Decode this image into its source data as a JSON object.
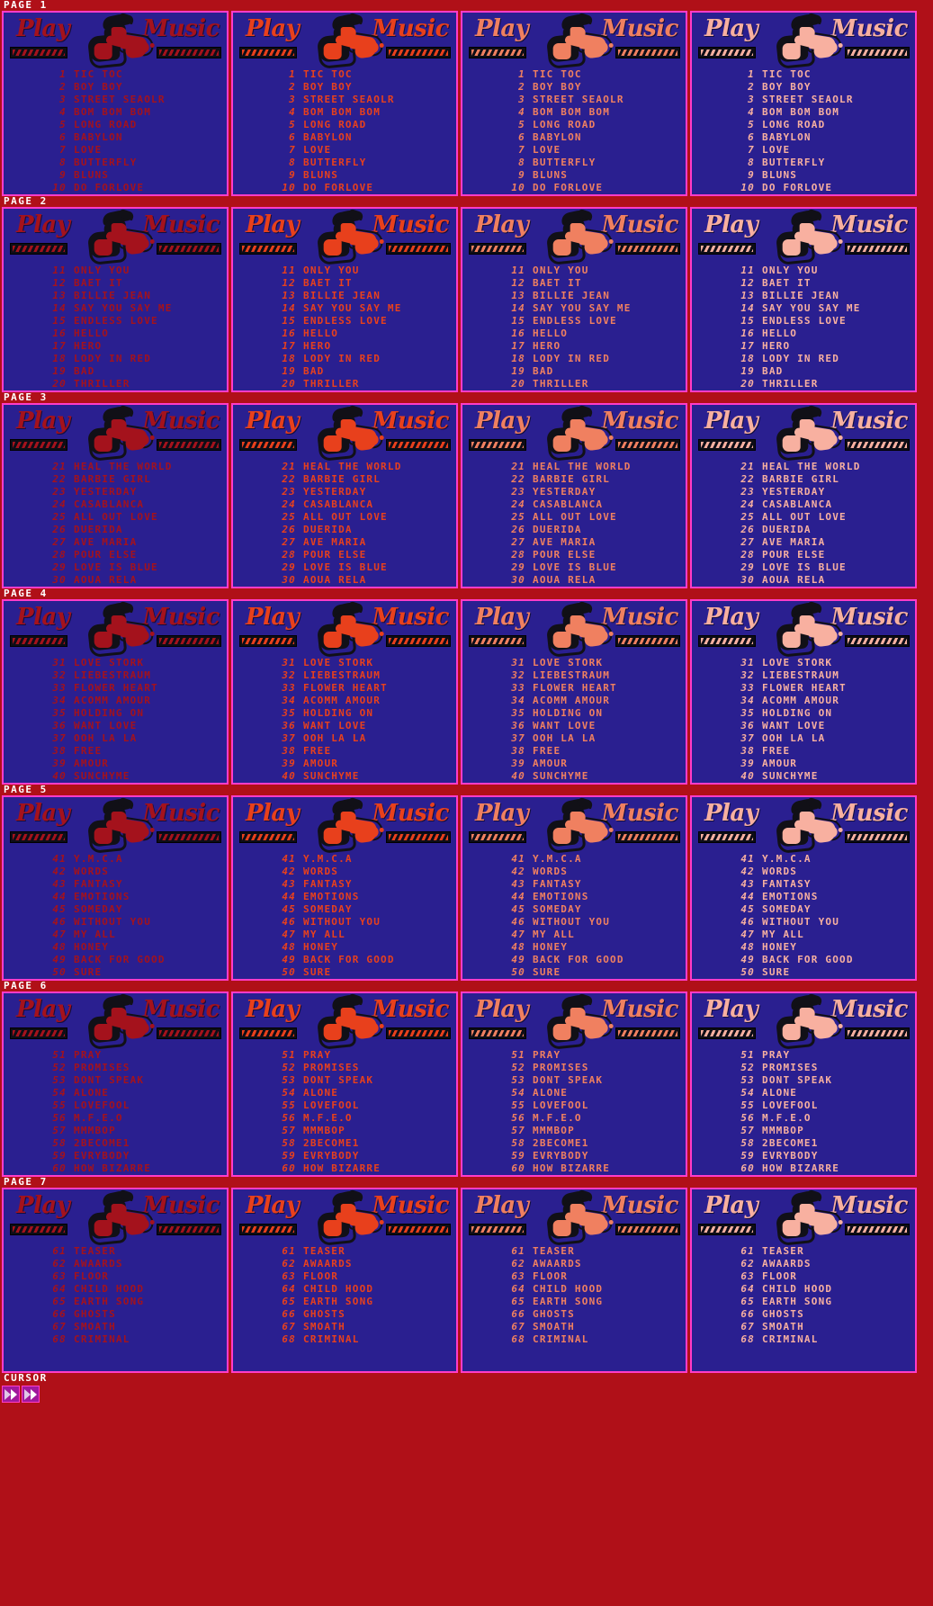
{
  "app": {
    "logo_left": "Play",
    "logo_right": "Music",
    "cursor_label": "CURSOR",
    "background_color": "#b01018",
    "panel_bg_color": "#2a1f90",
    "panel_border_color": "#ff3cc8",
    "header_text_color": "#ffffff"
  },
  "palette": {
    "variant_1": "#a4121c",
    "variant_2": "#e8401c",
    "variant_3": "#f08060",
    "variant_4": "#f8b0a0"
  },
  "variants": [
    {
      "id": "dark-red",
      "color": "#a4121c",
      "label": "variant-1"
    },
    {
      "id": "orange-red",
      "color": "#e8401c",
      "label": "variant-2"
    },
    {
      "id": "salmon",
      "color": "#f08060",
      "label": "variant-3"
    },
    {
      "id": "pale-pink",
      "color": "#f8b0a0",
      "label": "variant-4"
    }
  ],
  "pages": [
    {
      "label": "PAGE 1",
      "songs": [
        {
          "num": "1",
          "title": "TIC TOC"
        },
        {
          "num": "2",
          "title": "BOY BOY"
        },
        {
          "num": "3",
          "title": "STREET SEAOLR"
        },
        {
          "num": "4",
          "title": "BOM BOM BOM"
        },
        {
          "num": "5",
          "title": "LONG ROAD"
        },
        {
          "num": "6",
          "title": "BABYLON"
        },
        {
          "num": "7",
          "title": "LOVE"
        },
        {
          "num": "8",
          "title": "BUTTERFLY"
        },
        {
          "num": "9",
          "title": "BLUNS"
        },
        {
          "num": "10",
          "title": "DO FORLOVE"
        }
      ]
    },
    {
      "label": "PAGE 2",
      "songs": [
        {
          "num": "11",
          "title": "ONLY YOU"
        },
        {
          "num": "12",
          "title": "BAET IT"
        },
        {
          "num": "13",
          "title": "BILLIE JEAN"
        },
        {
          "num": "14",
          "title": "SAY YOU SAY ME"
        },
        {
          "num": "15",
          "title": "ENDLESS LOVE"
        },
        {
          "num": "16",
          "title": "HELLO"
        },
        {
          "num": "17",
          "title": "HERO"
        },
        {
          "num": "18",
          "title": "LODY IN RED"
        },
        {
          "num": "19",
          "title": "BAD"
        },
        {
          "num": "20",
          "title": "THRILLER"
        }
      ]
    },
    {
      "label": "PAGE 3",
      "songs": [
        {
          "num": "21",
          "title": "HEAL THE WORLD"
        },
        {
          "num": "22",
          "title": "BARBIE GIRL"
        },
        {
          "num": "23",
          "title": "YESTERDAY"
        },
        {
          "num": "24",
          "title": "CASABLANCA"
        },
        {
          "num": "25",
          "title": "ALL OUT LOVE"
        },
        {
          "num": "26",
          "title": "DUERIDA"
        },
        {
          "num": "27",
          "title": "AVE MARIA"
        },
        {
          "num": "28",
          "title": "POUR ELSE"
        },
        {
          "num": "29",
          "title": "LOVE IS BLUE"
        },
        {
          "num": "30",
          "title": "AOUA RELA"
        }
      ]
    },
    {
      "label": "PAGE 4",
      "songs": [
        {
          "num": "31",
          "title": "LOVE STORK"
        },
        {
          "num": "32",
          "title": "LIEBESTRAUM"
        },
        {
          "num": "33",
          "title": "FLOWER HEART"
        },
        {
          "num": "34",
          "title": "ACOMM AMOUR"
        },
        {
          "num": "35",
          "title": "HOLDING ON"
        },
        {
          "num": "36",
          "title": "WANT LOVE"
        },
        {
          "num": "37",
          "title": "OOH LA LA"
        },
        {
          "num": "38",
          "title": "FREE"
        },
        {
          "num": "39",
          "title": "AMOUR"
        },
        {
          "num": "40",
          "title": "SUNCHYME"
        }
      ]
    },
    {
      "label": "PAGE 5",
      "songs": [
        {
          "num": "41",
          "title": "Y.M.C.A"
        },
        {
          "num": "42",
          "title": "WORDS"
        },
        {
          "num": "43",
          "title": "FANTASY"
        },
        {
          "num": "44",
          "title": "EMOTIONS"
        },
        {
          "num": "45",
          "title": "SOMEDAY"
        },
        {
          "num": "46",
          "title": "WITHOUT YOU"
        },
        {
          "num": "47",
          "title": "MY ALL"
        },
        {
          "num": "48",
          "title": "HONEY"
        },
        {
          "num": "49",
          "title": "BACK FOR GOOD"
        },
        {
          "num": "50",
          "title": "SURE"
        }
      ]
    },
    {
      "label": "PAGE 6",
      "songs": [
        {
          "num": "51",
          "title": "PRAY"
        },
        {
          "num": "52",
          "title": "PROMISES"
        },
        {
          "num": "53",
          "title": "DONT SPEAK"
        },
        {
          "num": "54",
          "title": "ALONE"
        },
        {
          "num": "55",
          "title": "LOVEFOOL"
        },
        {
          "num": "56",
          "title": "M.F.E.O"
        },
        {
          "num": "57",
          "title": "MMMBOP"
        },
        {
          "num": "58",
          "title": "2BECOME1"
        },
        {
          "num": "59",
          "title": "EVRYBODY"
        },
        {
          "num": "60",
          "title": "HOW BIZARRE"
        }
      ]
    },
    {
      "label": "PAGE 7",
      "songs": [
        {
          "num": "61",
          "title": "TEASER"
        },
        {
          "num": "62",
          "title": "AWAARDS"
        },
        {
          "num": "63",
          "title": "FLOOR"
        },
        {
          "num": "64",
          "title": "CHILD HOOD"
        },
        {
          "num": "65",
          "title": "EARTH SONG"
        },
        {
          "num": "66",
          "title": "GHOSTS"
        },
        {
          "num": "67",
          "title": "SMOATH"
        },
        {
          "num": "68",
          "title": "CRIMINAL"
        }
      ]
    }
  ],
  "cursor": {
    "label": "CURSOR",
    "sprites": [
      {
        "name": "cursor-arrow-1",
        "icon": "double-chevron-right-icon"
      },
      {
        "name": "cursor-arrow-2",
        "icon": "double-chevron-right-icon"
      }
    ]
  }
}
